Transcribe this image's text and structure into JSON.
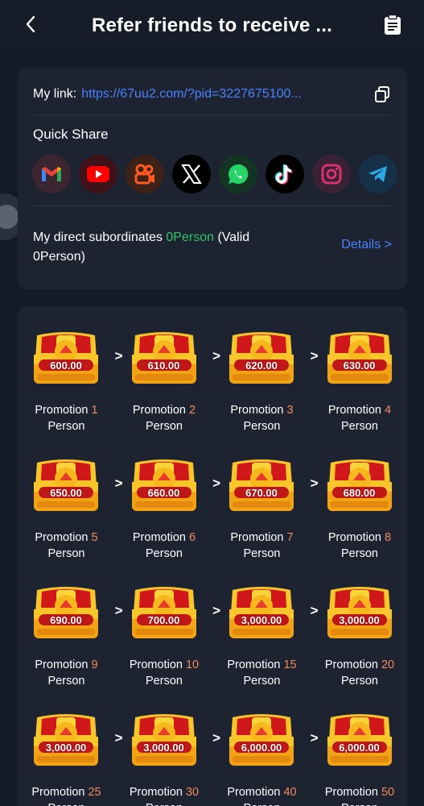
{
  "header": {
    "title": "Refer friends to receive ...",
    "back_icon": "chevron-left-icon",
    "clipboard_icon": "clipboard-icon"
  },
  "link": {
    "label": "My link:",
    "url": "https://67uu2.com/?pid=3227675100..."
  },
  "quick_share": {
    "label": "Quick Share",
    "items": [
      {
        "name": "gmail",
        "icon": "gmail-icon",
        "bg": "#3a2530"
      },
      {
        "name": "youtube",
        "icon": "youtube-icon",
        "bg": "#3e1218"
      },
      {
        "name": "kuaishou",
        "icon": "kuaishou-icon",
        "bg": "#3e2218"
      },
      {
        "name": "x",
        "icon": "x-icon",
        "bg": "#000000"
      },
      {
        "name": "whatsapp",
        "icon": "whatsapp-icon",
        "bg": "#143524"
      },
      {
        "name": "tiktok",
        "icon": "tiktok-icon",
        "bg": "#000000"
      },
      {
        "name": "instagram",
        "icon": "instagram-icon",
        "bg": "#3a2236"
      },
      {
        "name": "telegram",
        "icon": "telegram-icon",
        "bg": "#16304a"
      }
    ]
  },
  "subordinates": {
    "prefix": "My direct subordinates ",
    "count": "0Person",
    "suffix": " (Valid 0Person)",
    "details_label": "Details >"
  },
  "rewards": [
    {
      "amount": "600.00",
      "word": "Promotion",
      "count": "1",
      "unit": "Person"
    },
    {
      "amount": "610.00",
      "word": "Promotion",
      "count": "2",
      "unit": "Person"
    },
    {
      "amount": "620.00",
      "word": "Promotion",
      "count": "3",
      "unit": "Person"
    },
    {
      "amount": "630.00",
      "word": "Promotion",
      "count": "4",
      "unit": "Person"
    },
    {
      "amount": "650.00",
      "word": "Promotion",
      "count": "5",
      "unit": "Person"
    },
    {
      "amount": "660.00",
      "word": "Promotion",
      "count": "6",
      "unit": "Person"
    },
    {
      "amount": "670.00",
      "word": "Promotion",
      "count": "7",
      "unit": "Person"
    },
    {
      "amount": "680.00",
      "word": "Promotion",
      "count": "8",
      "unit": "Person"
    },
    {
      "amount": "690.00",
      "word": "Promotion",
      "count": "9",
      "unit": "Person"
    },
    {
      "amount": "700.00",
      "word": "Promotion",
      "count": "10",
      "unit": "Person"
    },
    {
      "amount": "3,000.00",
      "word": "Promotion",
      "count": "15",
      "unit": "Person"
    },
    {
      "amount": "3,000.00",
      "word": "Promotion",
      "count": "20",
      "unit": "Person"
    },
    {
      "amount": "3,000.00",
      "word": "Promotion",
      "count": "25",
      "unit": "Person"
    },
    {
      "amount": "3,000.00",
      "word": "Promotion",
      "count": "30",
      "unit": "Person"
    },
    {
      "amount": "6,000.00",
      "word": "Promotion",
      "count": "40",
      "unit": "Person"
    },
    {
      "amount": "6,000.00",
      "word": "Promotion",
      "count": "50",
      "unit": "Person"
    }
  ],
  "colors": {
    "accent": "#4a82ff",
    "green": "#33c46a",
    "orange": "#f28a5c",
    "card": "#1d2331",
    "background": "#151a27"
  }
}
